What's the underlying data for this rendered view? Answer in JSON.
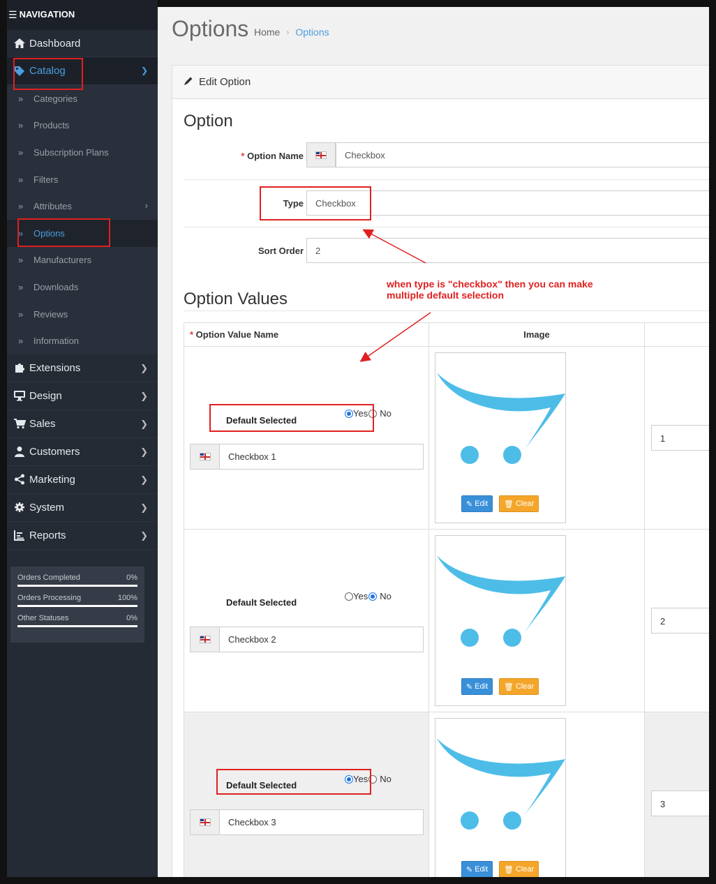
{
  "nav": {
    "header": "NAVIGATION",
    "items": [
      {
        "label": "Dashboard",
        "icon": "home-icon"
      },
      {
        "label": "Catalog",
        "icon": "tag-icon"
      },
      {
        "label": "Extensions",
        "icon": "puzzle-icon"
      },
      {
        "label": "Design",
        "icon": "desktop-icon"
      },
      {
        "label": "Sales",
        "icon": "cart-icon"
      },
      {
        "label": "Customers",
        "icon": "user-icon"
      },
      {
        "label": "Marketing",
        "icon": "share-icon"
      },
      {
        "label": "System",
        "icon": "gear-icon"
      },
      {
        "label": "Reports",
        "icon": "bar-chart-icon"
      }
    ],
    "catalog_sub": [
      {
        "label": "Categories"
      },
      {
        "label": "Products"
      },
      {
        "label": "Subscription Plans"
      },
      {
        "label": "Filters"
      },
      {
        "label": "Attributes"
      },
      {
        "label": "Options"
      },
      {
        "label": "Manufacturers"
      },
      {
        "label": "Downloads"
      },
      {
        "label": "Reviews"
      },
      {
        "label": "Information"
      }
    ],
    "stats": [
      {
        "label": "Orders Completed",
        "value": "0%",
        "progress": 0
      },
      {
        "label": "Orders Processing",
        "value": "100%",
        "progress": 100
      },
      {
        "label": "Other Statuses",
        "value": "0%",
        "progress": 0
      }
    ]
  },
  "page": {
    "title": "Options",
    "breadcrumb": [
      "Home",
      "Options"
    ],
    "panel_heading": "Edit Option"
  },
  "option": {
    "section_title": "Option",
    "name_label": "Option Name",
    "name_value": "Checkbox",
    "type_label": "Type",
    "type_value": "Checkbox",
    "sort_label": "Sort Order",
    "sort_value": "2"
  },
  "values": {
    "section_title": "Option Values",
    "headers": {
      "name": "Option Value Name",
      "image": "Image"
    },
    "default_label": "Default Selected",
    "yes_label": "Yes",
    "no_label": "No",
    "edit_label": "Edit",
    "clear_label": "Clear",
    "rows": [
      {
        "name": "Checkbox 1",
        "default": "yes",
        "sort": "1"
      },
      {
        "name": "Checkbox 2",
        "default": "no",
        "sort": "2"
      },
      {
        "name": "Checkbox 3",
        "default": "yes",
        "sort": "3"
      }
    ]
  },
  "annotation": {
    "line1": "when type is \"checkbox\" then you can make",
    "line2": "multiple default selection",
    "color": "#e02020"
  },
  "colors": {
    "accent": "#4a9de0",
    "sidebar_bg": "#252b35",
    "edit_button": "#3a8fd9",
    "clear_button": "#f4a62a",
    "logo_blue": "#4dbde8"
  }
}
